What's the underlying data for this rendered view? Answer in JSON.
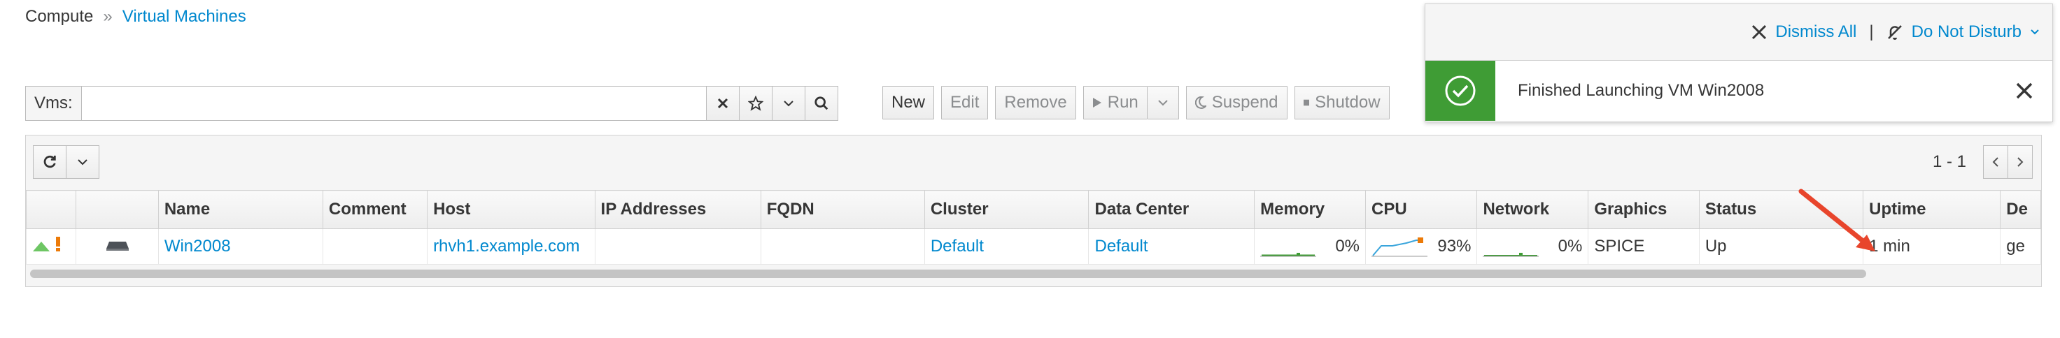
{
  "breadcrumb": {
    "root": "Compute",
    "separator": "»",
    "current": "Virtual Machines"
  },
  "search": {
    "label": "Vms:",
    "value": ""
  },
  "toolbar": {
    "new": "New",
    "edit": "Edit",
    "remove": "Remove",
    "run": "Run",
    "suspend": "Suspend",
    "shutdown": "Shutdow"
  },
  "pager": {
    "range": "1 - 1"
  },
  "table": {
    "columns": [
      "Name",
      "Comment",
      "Host",
      "IP Addresses",
      "FQDN",
      "Cluster",
      "Data Center",
      "Memory",
      "CPU",
      "Network",
      "Graphics",
      "Status",
      "Uptime",
      "De"
    ],
    "row": {
      "name": "Win2008",
      "comment": "",
      "host": "rhvh1.example.com",
      "ip": "",
      "fqdn": "",
      "cluster": "Default",
      "datacenter": "Default",
      "memory": "0%",
      "cpu": "93%",
      "network": "0%",
      "graphics": "SPICE",
      "status": "Up",
      "uptime": "1 min",
      "description": "ge"
    }
  },
  "notifications": {
    "dismiss_all": "Dismiss All",
    "separator": "|",
    "do_not_disturb": "Do Not Disturb",
    "toast_message": "Finished Launching VM Win2008"
  },
  "colors": {
    "link": "#0088ce",
    "success": "#3f9c35",
    "arrow": "#e8452c"
  }
}
